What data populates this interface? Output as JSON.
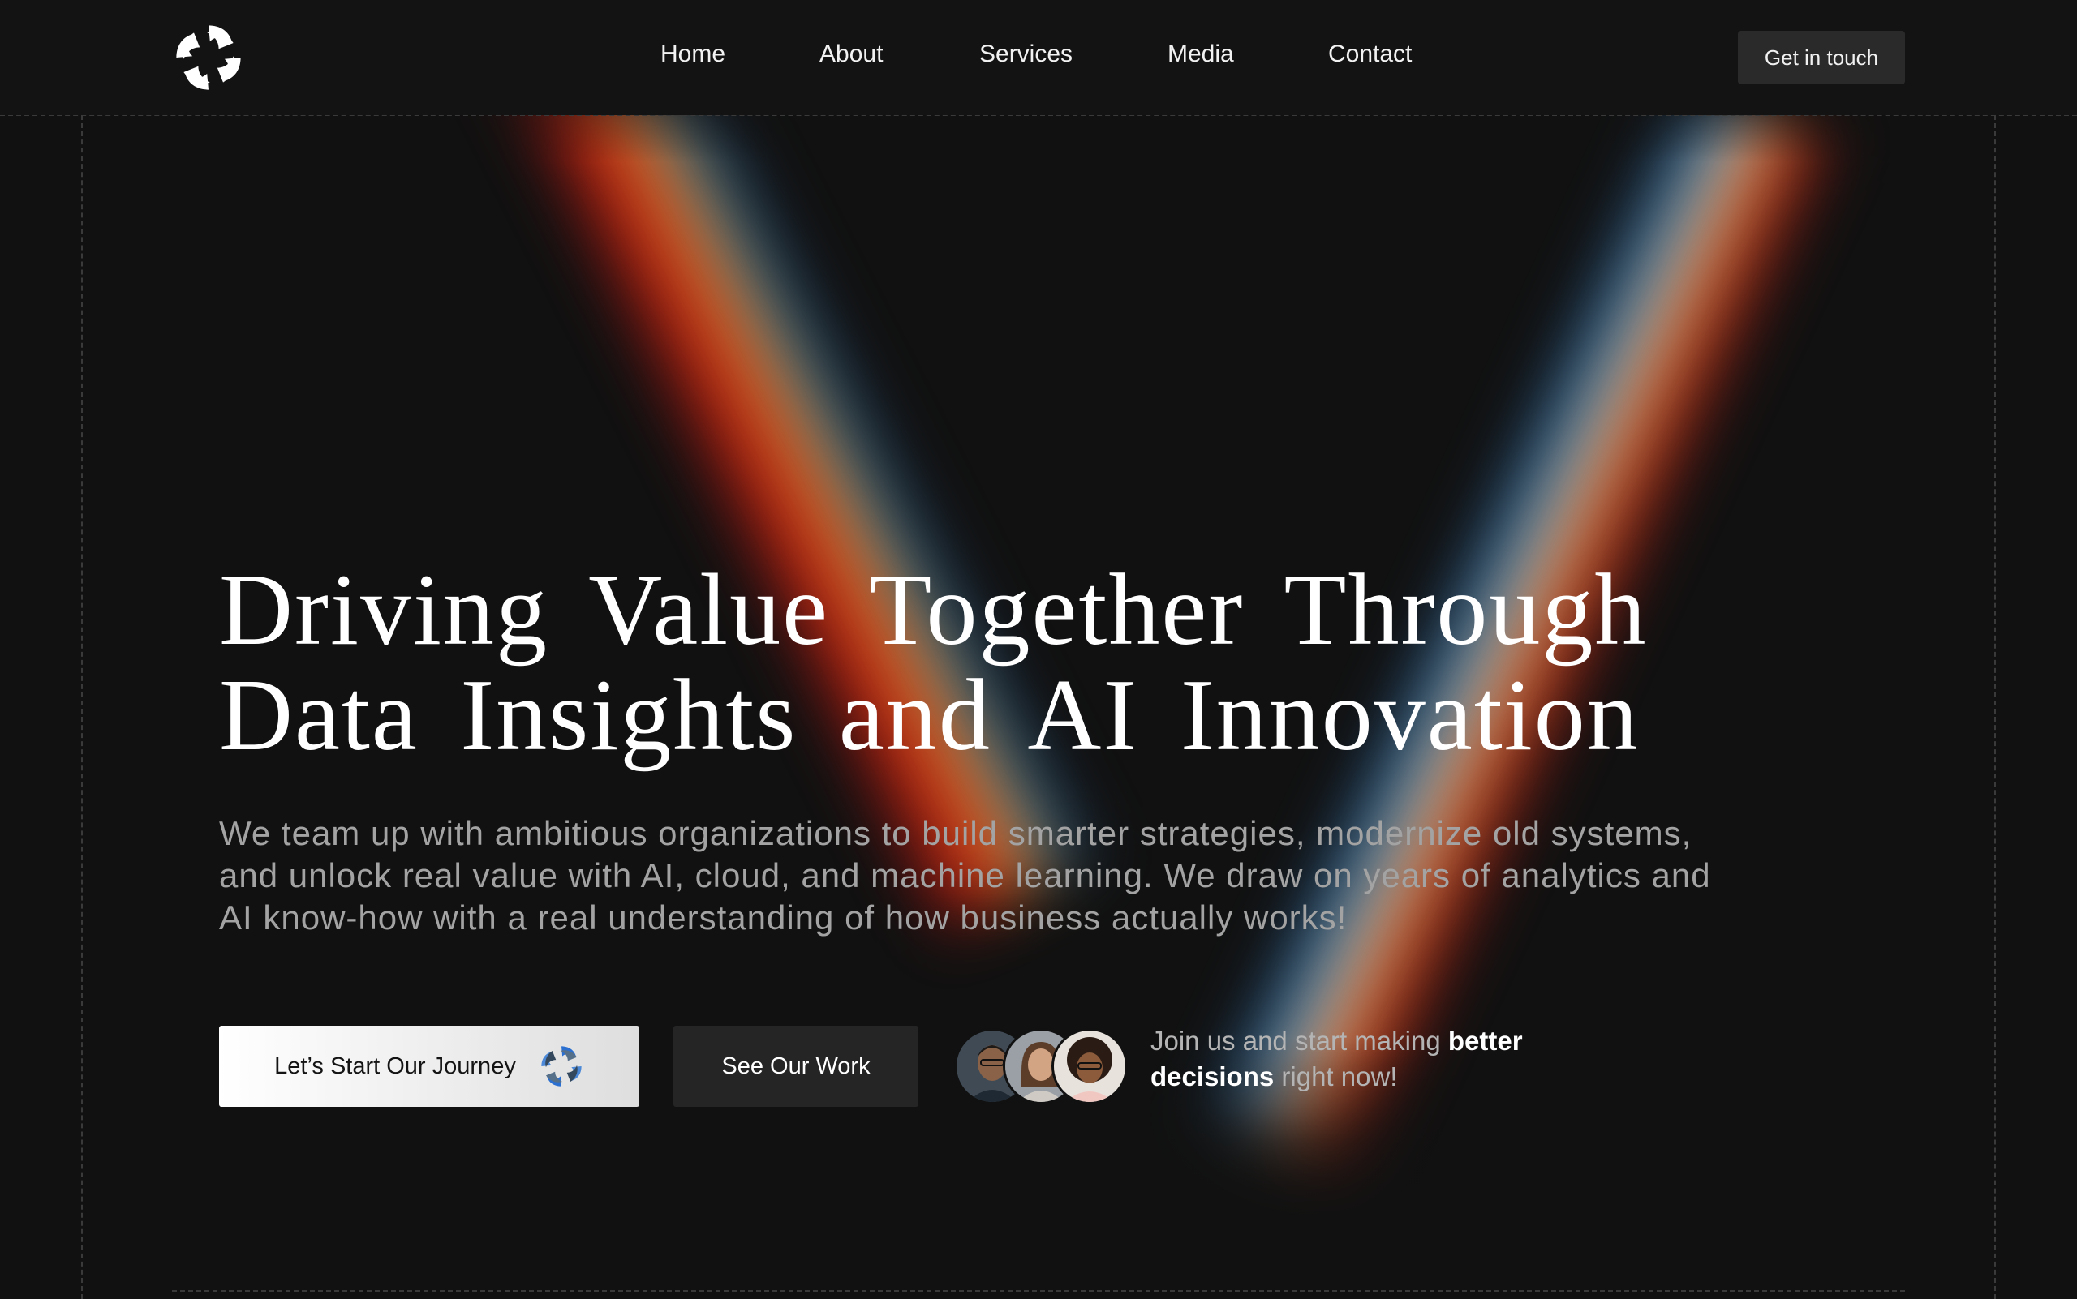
{
  "nav": {
    "items": [
      {
        "label": "Home"
      },
      {
        "label": "About"
      },
      {
        "label": "Services"
      },
      {
        "label": "Media"
      },
      {
        "label": "Contact"
      }
    ],
    "cta_label": "Get in touch"
  },
  "hero": {
    "title_line1": "Driving Value Together Through",
    "title_line2": "Data Insights and AI Innovation",
    "subtitle": "We team up with ambitious organizations to build smarter strategies, modernize old systems, and unlock real value with AI, cloud, and machine learning. We draw on years of analytics and AI know-how with a real understanding of how business actually works!",
    "primary_button": "Let’s Start Our Journey",
    "secondary_button": "See Our Work",
    "social_proof": {
      "prefix": "Join us and start making ",
      "bold": "better decisions",
      "suffix": " right now!"
    }
  },
  "icons": {
    "logo": "pinwheel-logo-icon",
    "button_icon": "pinwheel-icon"
  },
  "colors": {
    "background": "#111111",
    "header_background": "#131313",
    "secondary_button": "#252525",
    "muted_text": "#a3a3a3"
  }
}
